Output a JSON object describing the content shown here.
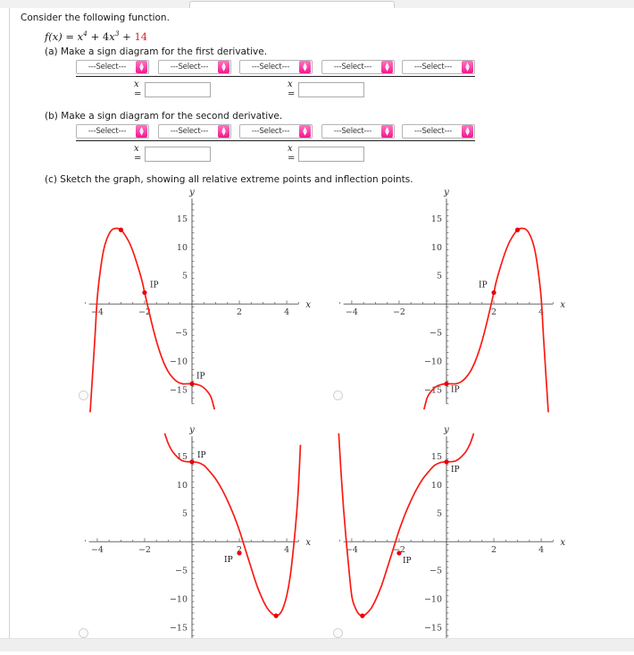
{
  "prompt": "Consider the following function.",
  "function": {
    "lhs": "f(x)",
    "eq": "=",
    "term1_base": "x",
    "term1_exp": "4",
    "plus1": "+",
    "term2_coef": "4",
    "term2_base": "x",
    "term2_exp": "3",
    "plus2": "+",
    "constant": "14",
    "constant_color": "#d0252b"
  },
  "parts": {
    "a": "(a) Make a sign diagram for the first derivative.",
    "b": "(b) Make a sign diagram for the second derivative.",
    "c": "(c) Sketch the graph, showing all relative extreme points and inflection points."
  },
  "select_placeholder": "---Select---",
  "select_spinner_up": "▲",
  "select_spinner_down": "▼",
  "x_label": "x",
  "x_equals": "=",
  "x_input_value": "",
  "sign_diagram_a": {
    "selects": [
      "---Select---",
      "---Select---",
      "---Select---",
      "---Select---",
      "---Select---"
    ],
    "x_fields": [
      {
        "label": "x",
        "eq": "=",
        "value": ""
      },
      {
        "label": "x",
        "eq": "=",
        "value": ""
      }
    ]
  },
  "sign_diagram_b": {
    "selects": [
      "---Select---",
      "---Select---",
      "---Select---",
      "---Select---",
      "---Select---"
    ],
    "x_fields": [
      {
        "label": "x",
        "eq": "=",
        "value": ""
      },
      {
        "label": "x",
        "eq": "=",
        "value": ""
      }
    ]
  },
  "chart_data": [
    {
      "id": "choice-1",
      "type": "line",
      "title": "",
      "xlabel": "x",
      "ylabel": "y",
      "xlim": [
        -4.6,
        4.6
      ],
      "ylim": [
        -18,
        19
      ],
      "xticks": [
        -4,
        -2,
        2,
        4
      ],
      "yticks": [
        15,
        10,
        5,
        -5,
        -10,
        -15
      ],
      "grid": false,
      "legend": "none",
      "curve_expression": "-(x+4)^4 wave: reflected & shifted quartic",
      "points": [
        [
          -4.3,
          -19.0
        ],
        [
          -4.1,
          -6.0
        ],
        [
          -4.0,
          1.0
        ],
        [
          -3.85,
          6.5
        ],
        [
          -3.7,
          10.0
        ],
        [
          -3.5,
          12.3
        ],
        [
          -3.3,
          13.2
        ],
        [
          -3.0,
          13.0
        ],
        [
          -2.7,
          11.2
        ],
        [
          -2.5,
          9.3
        ],
        [
          -2.3,
          6.8
        ],
        [
          -2.1,
          3.9
        ],
        [
          -2.0,
          2.0
        ],
        [
          -1.8,
          -1.6
        ],
        [
          -1.6,
          -5.0
        ],
        [
          -1.4,
          -7.9
        ],
        [
          -1.2,
          -10.2
        ],
        [
          -1.0,
          -11.9
        ],
        [
          -0.8,
          -13.0
        ],
        [
          -0.6,
          -13.7
        ],
        [
          -0.4,
          -14.0
        ],
        [
          -0.2,
          -14.0
        ],
        [
          0.0,
          -14.0
        ],
        [
          0.2,
          -14.1
        ],
        [
          0.4,
          -14.4
        ],
        [
          0.6,
          -15.1
        ],
        [
          0.8,
          -16.3
        ],
        [
          0.95,
          -18.5
        ]
      ],
      "markers": [
        {
          "x": -3.0,
          "y": 13.0,
          "label": "",
          "label_dx": 0,
          "label_dy": 0
        },
        {
          "x": -2.0,
          "y": 2.0,
          "label": "IP",
          "label_dx": 6,
          "label_dy": -6
        },
        {
          "x": 0.0,
          "y": -14.0,
          "label": "IP",
          "label_dx": 5,
          "label_dy": -6
        }
      ]
    },
    {
      "id": "choice-2",
      "type": "line",
      "title": "",
      "xlabel": "x",
      "ylabel": "y",
      "xlim": [
        -4.6,
        4.6
      ],
      "ylim": [
        -18,
        19
      ],
      "xticks": [
        -4,
        -2,
        2,
        4
      ],
      "yticks": [
        15,
        10,
        5,
        -5,
        -10,
        -15
      ],
      "grid": false,
      "legend": "none",
      "curve_expression": "horizontal mirror of choice-1",
      "points": [
        [
          -0.95,
          -18.5
        ],
        [
          -0.8,
          -16.3
        ],
        [
          -0.6,
          -15.1
        ],
        [
          -0.4,
          -14.4
        ],
        [
          -0.2,
          -14.1
        ],
        [
          0.0,
          -14.0
        ],
        [
          0.2,
          -14.0
        ],
        [
          0.4,
          -14.0
        ],
        [
          0.6,
          -13.7
        ],
        [
          0.8,
          -13.0
        ],
        [
          1.0,
          -11.9
        ],
        [
          1.2,
          -10.2
        ],
        [
          1.4,
          -7.9
        ],
        [
          1.6,
          -5.0
        ],
        [
          1.8,
          -1.6
        ],
        [
          2.0,
          2.0
        ],
        [
          2.1,
          3.9
        ],
        [
          2.3,
          6.8
        ],
        [
          2.5,
          9.3
        ],
        [
          2.7,
          11.2
        ],
        [
          3.0,
          13.0
        ],
        [
          3.3,
          13.2
        ],
        [
          3.5,
          12.3
        ],
        [
          3.7,
          10.0
        ],
        [
          3.85,
          6.5
        ],
        [
          4.0,
          1.0
        ],
        [
          4.1,
          -6.0
        ],
        [
          4.3,
          -19.0
        ]
      ],
      "markers": [
        {
          "x": 3.0,
          "y": 13.0,
          "label": "",
          "label_dx": 0,
          "label_dy": 0
        },
        {
          "x": 2.0,
          "y": 2.0,
          "label": "IP",
          "label_dx": -17,
          "label_dy": -6
        },
        {
          "x": 0.0,
          "y": -14.0,
          "label": "IP",
          "label_dx": 5,
          "label_dy": 9
        }
      ]
    },
    {
      "id": "choice-3",
      "type": "line",
      "title": "",
      "xlabel": "x",
      "ylabel": "y",
      "xlim": [
        -4.6,
        4.6
      ],
      "ylim": [
        -18,
        19
      ],
      "xticks": [
        -4,
        -2,
        2,
        4
      ],
      "yticks": [
        15,
        10,
        5,
        -5,
        -10,
        -15
      ],
      "grid": false,
      "legend": "none",
      "curve_expression": "vertical mirror of choice-4 (x -> -x)",
      "points": [
        [
          -1.15,
          19.0
        ],
        [
          -1.0,
          17.2
        ],
        [
          -0.85,
          16.0
        ],
        [
          -0.7,
          15.2
        ],
        [
          -0.55,
          14.6
        ],
        [
          -0.4,
          14.2
        ],
        [
          -0.25,
          14.05
        ],
        [
          0.0,
          14.0
        ],
        [
          0.25,
          13.9
        ],
        [
          0.5,
          13.4
        ],
        [
          0.75,
          12.3
        ],
        [
          1.0,
          11.0
        ],
        [
          1.25,
          9.3
        ],
        [
          1.5,
          7.2
        ],
        [
          1.75,
          4.8
        ],
        [
          2.0,
          2.0
        ],
        [
          2.1,
          0.7
        ],
        [
          2.25,
          -1.3
        ],
        [
          2.5,
          -4.6
        ],
        [
          2.75,
          -7.8
        ],
        [
          3.0,
          -10.3
        ],
        [
          3.2,
          -11.8
        ],
        [
          3.4,
          -12.7
        ],
        [
          3.55,
          -13.0
        ],
        [
          3.7,
          -12.7
        ],
        [
          3.85,
          -11.6
        ],
        [
          4.0,
          -9.5
        ],
        [
          4.15,
          -6.0
        ],
        [
          4.3,
          -0.5
        ],
        [
          4.42,
          5.0
        ],
        [
          4.5,
          10.0
        ],
        [
          4.58,
          17.0
        ]
      ],
      "markers": [
        {
          "x": 0.0,
          "y": 14.0,
          "label": "IP",
          "label_dx": 6,
          "label_dy": -5
        },
        {
          "x": 2.0,
          "y": -2.0,
          "label": "IP",
          "label_dx": -17,
          "label_dy": 10
        },
        {
          "x": 3.55,
          "y": -13.0,
          "label": "",
          "label_dx": 0,
          "label_dy": 0
        }
      ]
    },
    {
      "id": "choice-4",
      "type": "line",
      "title": "",
      "xlabel": "x",
      "ylabel": "y",
      "xlim": [
        -4.6,
        4.6
      ],
      "ylim": [
        -18,
        19
      ],
      "xticks": [
        -4,
        -2,
        2,
        4
      ],
      "yticks": [
        15,
        10,
        5,
        -5,
        -10,
        -15
      ],
      "grid": false,
      "legend": "none",
      "curve_expression": "f(x) = x^4 + 4x^3 + 14",
      "points": [
        [
          -4.55,
          19.0
        ],
        [
          -4.45,
          12.0
        ],
        [
          -4.35,
          6.0
        ],
        [
          -4.25,
          1.0
        ],
        [
          -4.15,
          -3.5
        ],
        [
          -4.0,
          -9.5
        ],
        [
          -3.85,
          -11.6
        ],
        [
          -3.7,
          -12.7
        ],
        [
          -3.55,
          -13.0
        ],
        [
          -3.4,
          -12.7
        ],
        [
          -3.2,
          -11.8
        ],
        [
          -3.0,
          -10.3
        ],
        [
          -2.75,
          -7.8
        ],
        [
          -2.5,
          -4.6
        ],
        [
          -2.25,
          -1.3
        ],
        [
          -2.1,
          0.7
        ],
        [
          -2.0,
          2.0
        ],
        [
          -1.75,
          4.8
        ],
        [
          -1.5,
          7.2
        ],
        [
          -1.25,
          9.3
        ],
        [
          -1.0,
          11.0
        ],
        [
          -0.75,
          12.3
        ],
        [
          -0.5,
          13.4
        ],
        [
          -0.25,
          13.9
        ],
        [
          0.0,
          14.0
        ],
        [
          0.25,
          14.05
        ],
        [
          0.4,
          14.2
        ],
        [
          0.55,
          14.6
        ],
        [
          0.7,
          15.2
        ],
        [
          0.85,
          16.0
        ],
        [
          1.0,
          17.2
        ],
        [
          1.15,
          19.0
        ]
      ],
      "markers": [
        {
          "x": -3.55,
          "y": -13.0,
          "label": "",
          "label_dx": 0,
          "label_dy": 0
        },
        {
          "x": -2.0,
          "y": -2.0,
          "label": "IP",
          "label_dx": 4,
          "label_dy": 11
        },
        {
          "x": 0.0,
          "y": 14.0,
          "label": "IP",
          "label_dx": 5,
          "label_dy": 11
        }
      ]
    }
  ],
  "radios": [
    {
      "id": "radio-choice-1",
      "checked": false
    },
    {
      "id": "radio-choice-2",
      "checked": false
    },
    {
      "id": "radio-choice-3",
      "checked": false
    },
    {
      "id": "radio-choice-4",
      "checked": false
    }
  ]
}
